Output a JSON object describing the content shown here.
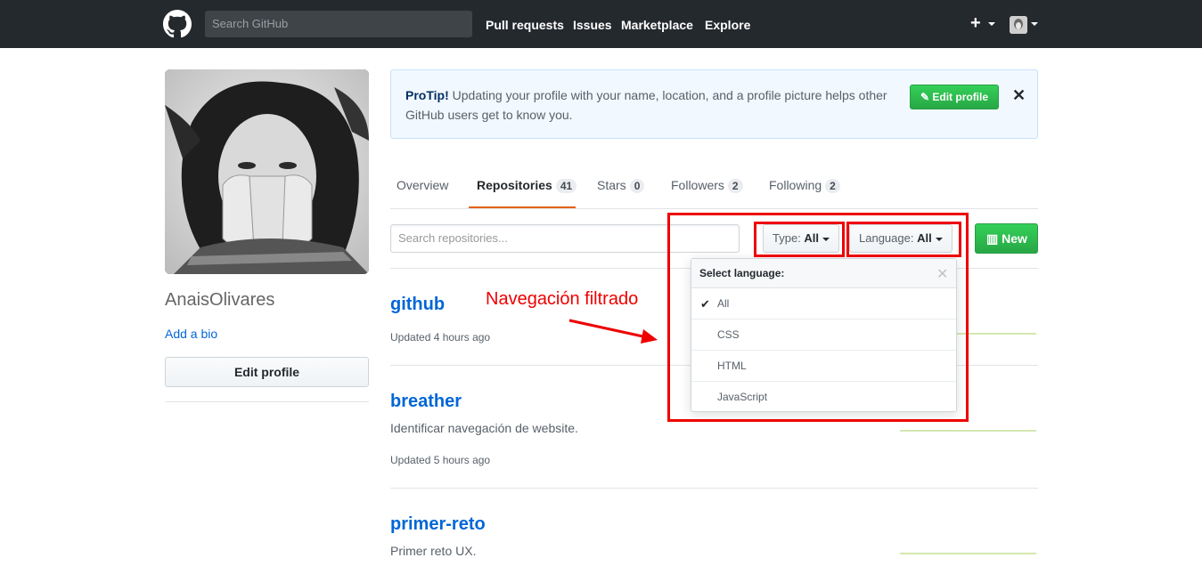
{
  "header": {
    "search_placeholder": "Search GitHub",
    "nav": [
      "Pull requests",
      "Issues",
      "Marketplace",
      "Explore"
    ],
    "plus_label": "+"
  },
  "sidebar": {
    "username": "AnaisOlivares",
    "add_bio": "Add a bio",
    "edit_profile": "Edit profile"
  },
  "protip": {
    "label": "ProTip!",
    "text": " Updating your profile with your name, location, and a profile picture helps other GitHub users get to know you.",
    "button": "Edit profile",
    "close": "✕"
  },
  "tabs": [
    {
      "label": "Overview",
      "count": ""
    },
    {
      "label": "Repositories",
      "count": "41"
    },
    {
      "label": "Stars",
      "count": "0"
    },
    {
      "label": "Followers",
      "count": "2"
    },
    {
      "label": "Following",
      "count": "2"
    }
  ],
  "filters": {
    "search_placeholder": "Search repositories...",
    "type_label": "Type:",
    "type_value": "All",
    "language_label": "Language:",
    "language_value": "All",
    "new_button": "New"
  },
  "dropdown": {
    "title": "Select language:",
    "close": "✕",
    "items": [
      "All",
      "CSS",
      "HTML",
      "JavaScript"
    ],
    "selected": "All"
  },
  "repos": [
    {
      "name": "github",
      "description": "",
      "updated": "Updated 4 hours ago"
    },
    {
      "name": "breather",
      "description": "Identificar navegación de website.",
      "updated": "Updated 5 hours ago"
    },
    {
      "name": "primer-reto",
      "description": "Primer reto UX.",
      "updated": ""
    }
  ],
  "annotation": {
    "text": "Navegación filtrado",
    "color": "#ee0000"
  },
  "colors": {
    "header_bg": "#24292e",
    "link": "#0366d6",
    "green": "#28a745",
    "active_tab": "#e36209"
  }
}
